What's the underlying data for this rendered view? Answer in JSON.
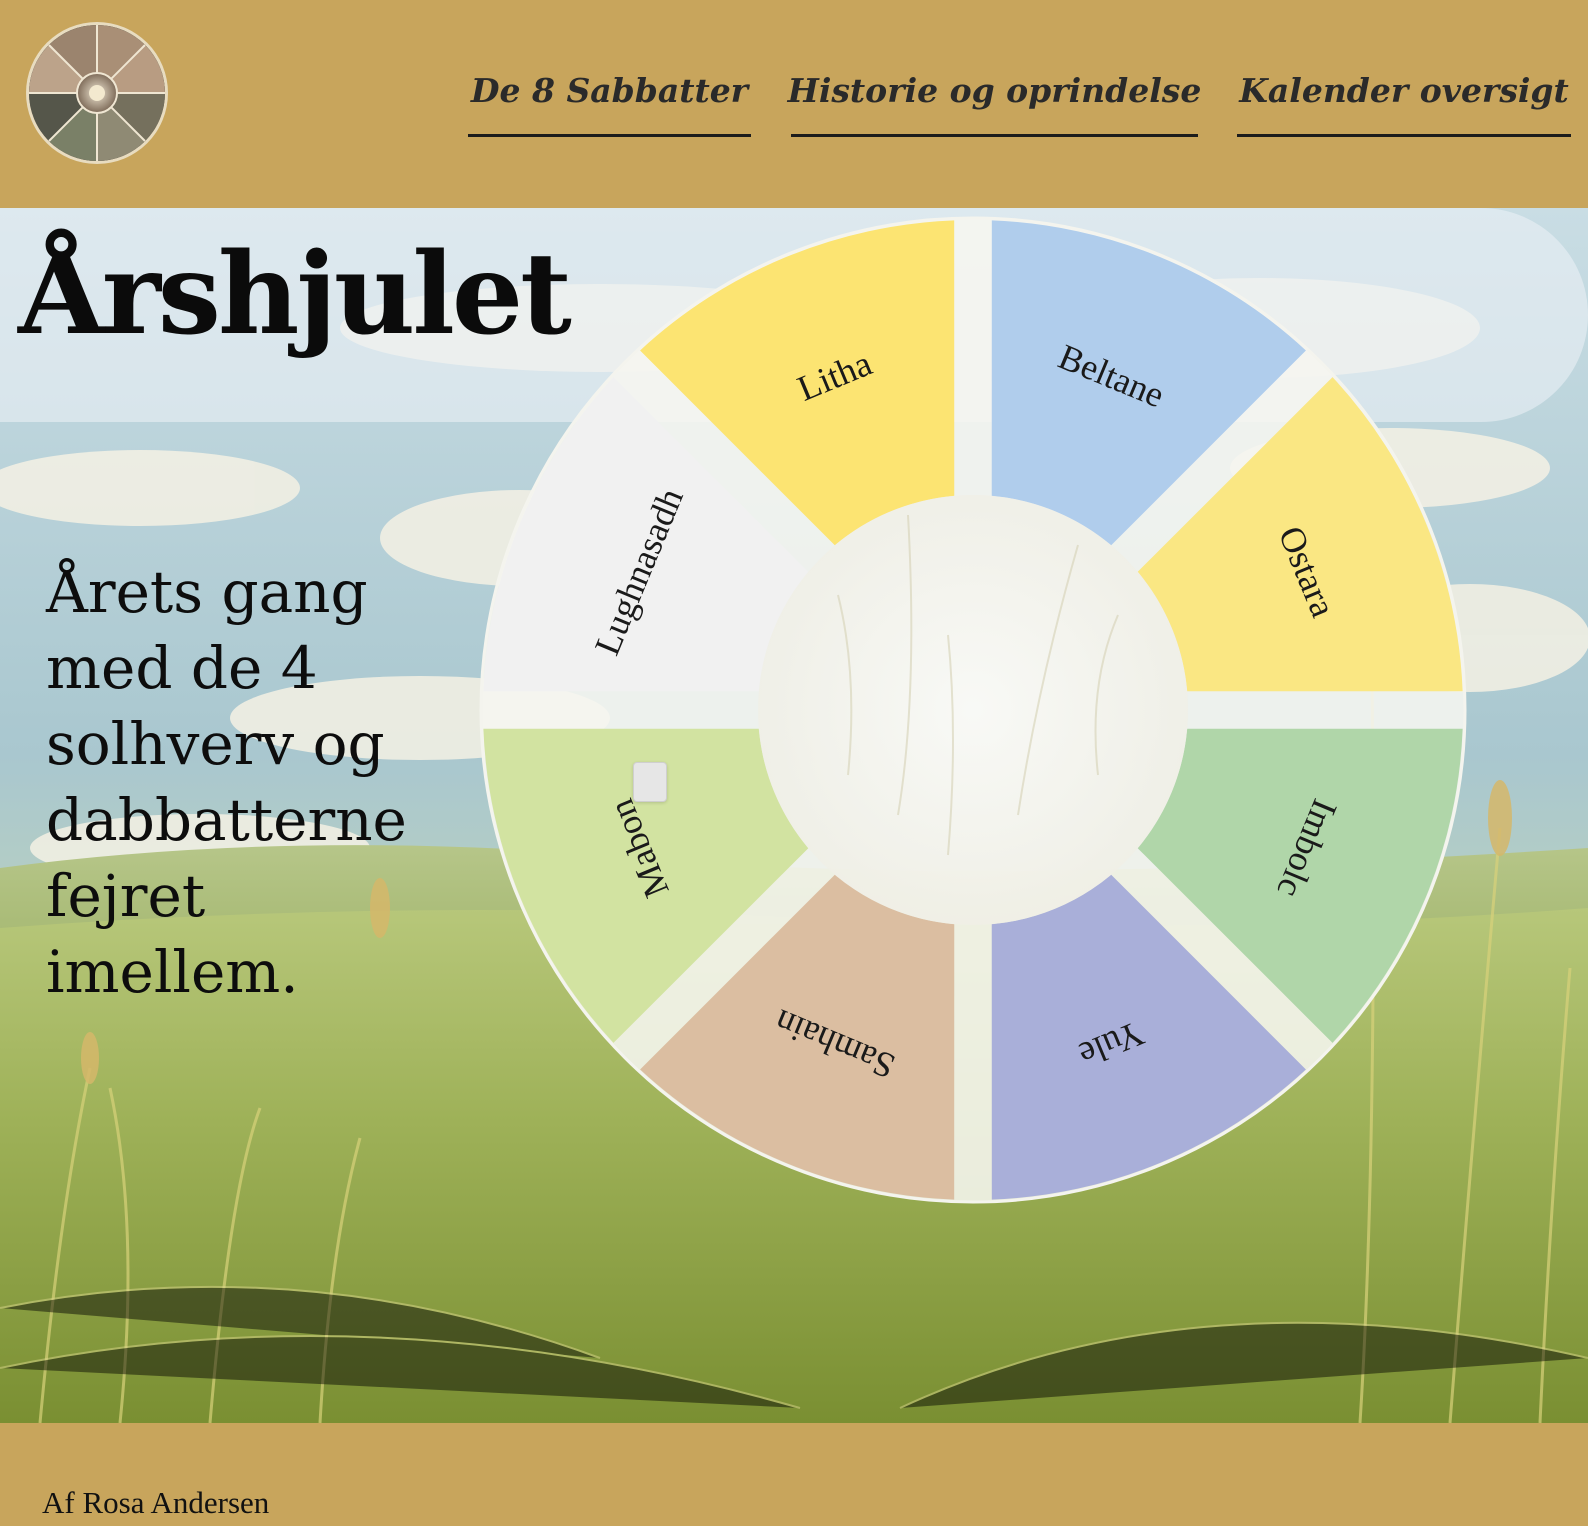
{
  "logo": {
    "icon": "wheel-of-year-logo-icon"
  },
  "nav": {
    "items": [
      {
        "label": "De 8 Sabbatter"
      },
      {
        "label": "Historie og oprindelse"
      },
      {
        "label": "Kalender oversigt"
      }
    ]
  },
  "hero": {
    "title": "Årshjulet",
    "subtitle": "Årets gang med de 4 solhverv og dabbatterne fejret imellem.",
    "background": "grass-field-sky-image"
  },
  "wheel": {
    "segments": [
      {
        "label": "Litha",
        "color": "#fce472"
      },
      {
        "label": "Beltane",
        "color": "#b0cdec"
      },
      {
        "label": "Ostara",
        "color": "#fae783"
      },
      {
        "label": "Imbolc",
        "color": "#b0d6a9"
      },
      {
        "label": "Yule",
        "color": "#a9afd9"
      },
      {
        "label": "Samhain",
        "color": "#dbbea1"
      },
      {
        "label": "Mabon",
        "color": "#d2e3a1"
      },
      {
        "label": "Lughnasadh",
        "color": "#f1f1f1"
      }
    ]
  },
  "footer": {
    "text": "Af Rosa Andersen"
  },
  "colors": {
    "header_bg": "#c8a55c",
    "nav_text": "#2a2a2a",
    "nav_underline": "#1c1c1c",
    "title_band": "#ecf2f6"
  }
}
